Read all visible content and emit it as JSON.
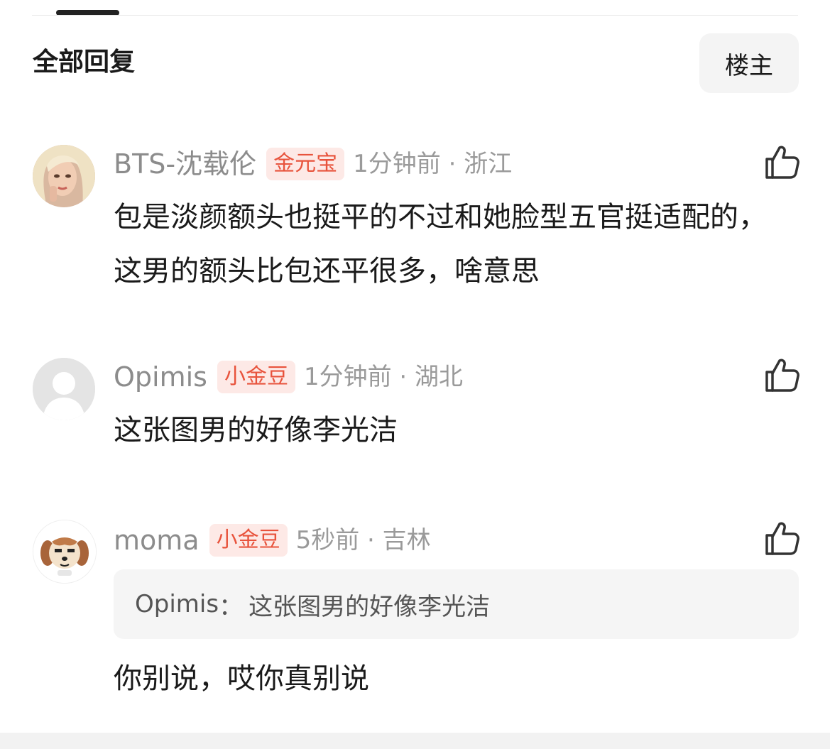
{
  "header": {
    "title": "全部回复",
    "filter_label": "楼主"
  },
  "comments": [
    {
      "username": "BTS-沈载伦",
      "badge": "金元宝",
      "time": "1分钟前",
      "location": "浙江",
      "content": "包是淡颜额头也挺平的不过和她脸型五官挺适配的，这男的额头比包还平很多，啥意思",
      "avatar": "blonde-woman-avatar",
      "like_icon": "thumbs-up-icon"
    },
    {
      "username": "Opimis",
      "badge": "小金豆",
      "time": "1分钟前",
      "location": "湖北",
      "content": "这张图男的好像李光洁",
      "avatar": "default-gray-avatar",
      "like_icon": "thumbs-up-icon"
    },
    {
      "username": "moma",
      "badge": "小金豆",
      "time": "5秒前",
      "location": "吉林",
      "quote": {
        "author": "Opimis",
        "separator": "：",
        "text": "这张图男的好像李光洁"
      },
      "content": "你别说，哎你真别说",
      "avatar": "cartoon-dog-avatar",
      "like_icon": "thumbs-up-icon"
    }
  ],
  "separator_dot": " · ",
  "colors": {
    "badge_bg": "#fde9e6",
    "badge_text": "#e8533c",
    "meta_gray": "#8c8c8c",
    "quote_bg": "#f5f5f5"
  }
}
